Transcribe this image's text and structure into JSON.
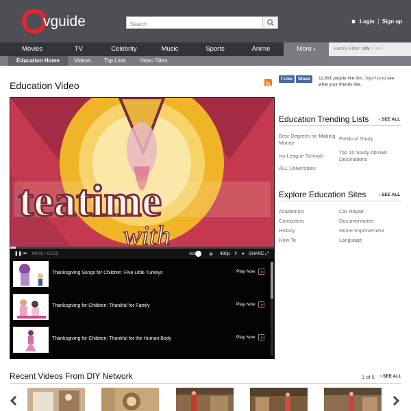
{
  "header": {
    "logo_text": "vguide",
    "search_placeholder": "Search",
    "login_label": "Login",
    "signup_label": "Sign up"
  },
  "nav": {
    "items": [
      "Movies",
      "TV",
      "Celebrity",
      "Music",
      "Sports",
      "Anime"
    ],
    "more_label": "More",
    "family_filter_label": "Family Filter:",
    "family_on": "ON",
    "family_off": "OFF"
  },
  "subnav": {
    "items": [
      "Education Home",
      "Videos",
      "Top Lists",
      "Video Sites"
    ]
  },
  "page": {
    "title": "Education Video",
    "fb_like": "Like",
    "fb_share": "Share",
    "fb_count_text": "11,891 people like this.",
    "fb_signup": "Sign Up",
    "fb_suffix": "to see what your friends like."
  },
  "player": {
    "time": "00:02 / 01:53",
    "quality": "480p",
    "share_label": "SHARE",
    "ad_label": "Ad",
    "playlist": [
      {
        "title": "Thanksgiving Songs for Children: Five Little Turkeys",
        "action": "Play Now"
      },
      {
        "title": "Thanksgiving for Children: Thankful for Family",
        "action": "Play Now"
      },
      {
        "title": "Thanksgiving for Children: Thankful for the Human Body",
        "action": "Play Now"
      }
    ],
    "progress_fraction": 0.02
  },
  "trending": {
    "heading": "Education Trending Lists",
    "see_all": "SEE ALL",
    "links": [
      "Best Degrees for Making Money",
      "Fields of Study",
      "Ivy League Schools",
      "Top 10 Study Abroad Destinations",
      "ALL Universities"
    ]
  },
  "explore": {
    "heading": "Explore Education Sites",
    "see_all": "SEE ALL",
    "links": [
      "Academics",
      "Car Repair",
      "Computers",
      "Documentaries",
      "History",
      "Home Improvement",
      "How To",
      "Language"
    ]
  },
  "recent": {
    "heading": "Recent Videos From DIY Network",
    "page_count": "1 of 5",
    "see_all": "SEE ALL"
  },
  "colors": {
    "brand_red": "#e8222f",
    "header_bg": "#4e4f55",
    "nav_bg": "#333437",
    "family_on": "#55a820"
  }
}
